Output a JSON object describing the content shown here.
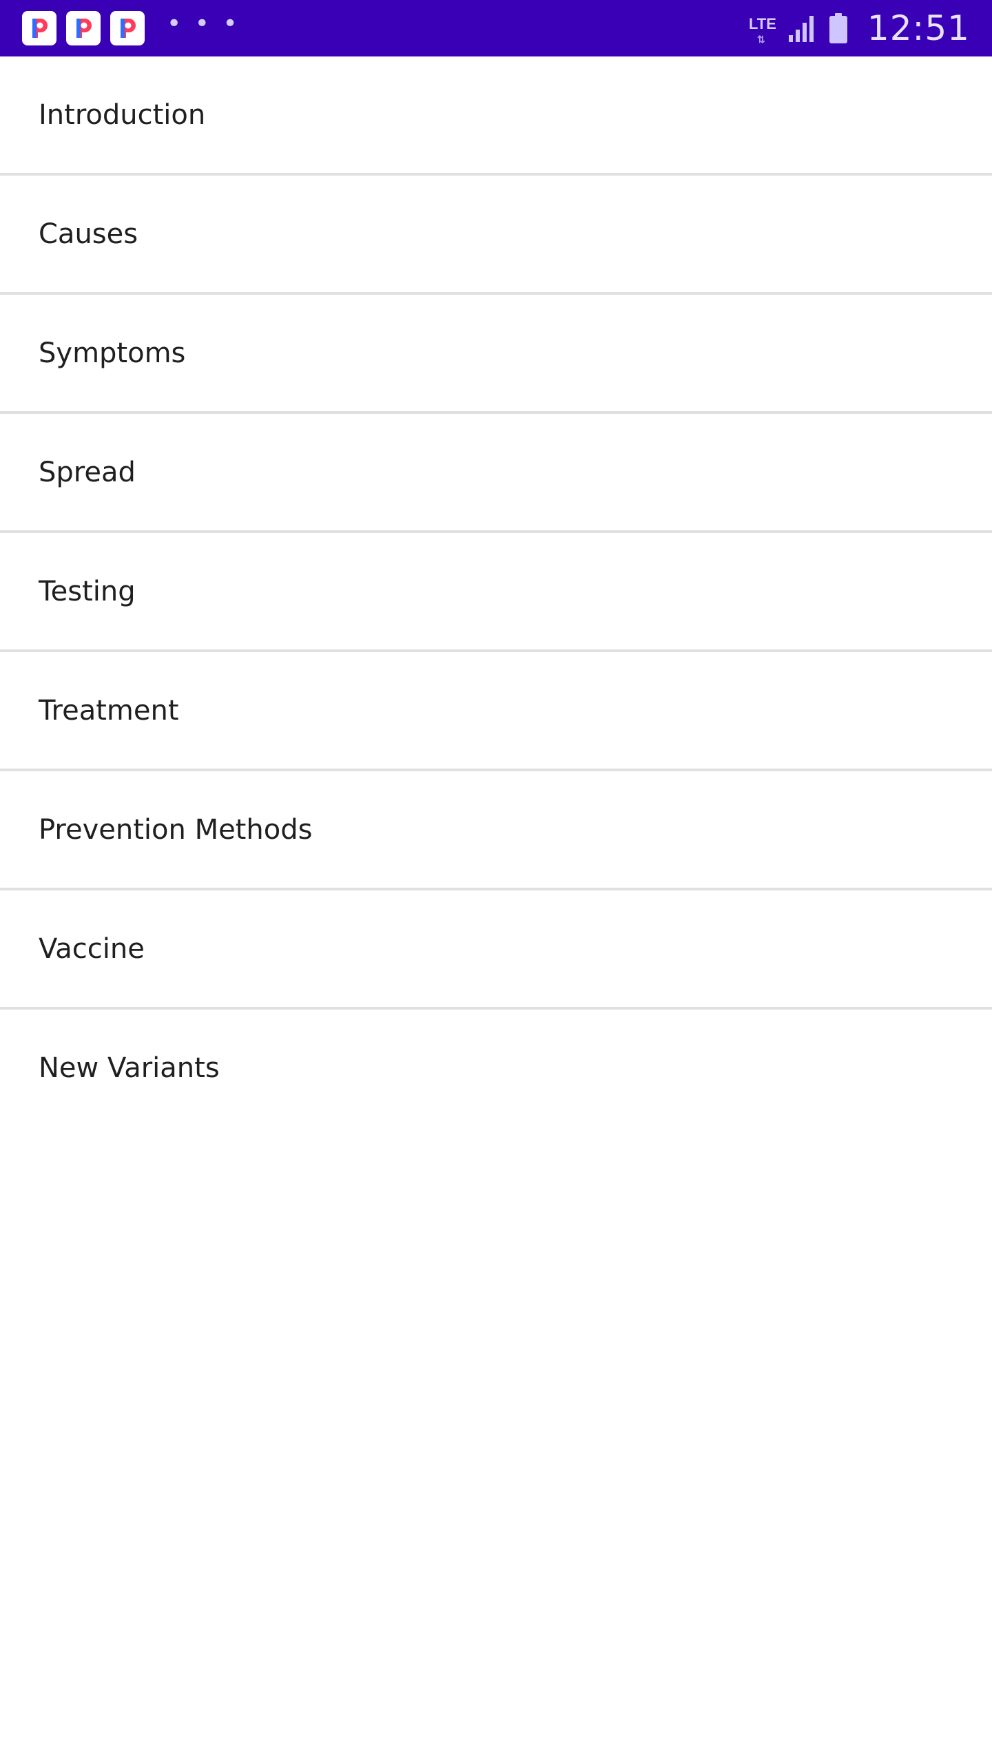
{
  "status_bar": {
    "background_color": "#3a00b5",
    "notification_icons": [
      "p-app-icon",
      "p-app-icon",
      "p-app-icon"
    ],
    "more_indicator": "• • •",
    "network_label": "LTE",
    "network_arrows": "⇅",
    "signal_icon": "signal-icon",
    "battery_icon": "battery-icon",
    "time": "12:51"
  },
  "topics": [
    {
      "label": "Introduction"
    },
    {
      "label": "Causes"
    },
    {
      "label": "Symptoms"
    },
    {
      "label": "Spread"
    },
    {
      "label": "Testing"
    },
    {
      "label": "Treatment"
    },
    {
      "label": "Prevention Methods"
    },
    {
      "label": "Vaccine"
    },
    {
      "label": "New Variants"
    }
  ],
  "colors": {
    "divider": "#e0e0e0",
    "text": "#1f1f1f",
    "icon_red": "#ff3b5c",
    "icon_blue": "#2f6cff"
  }
}
